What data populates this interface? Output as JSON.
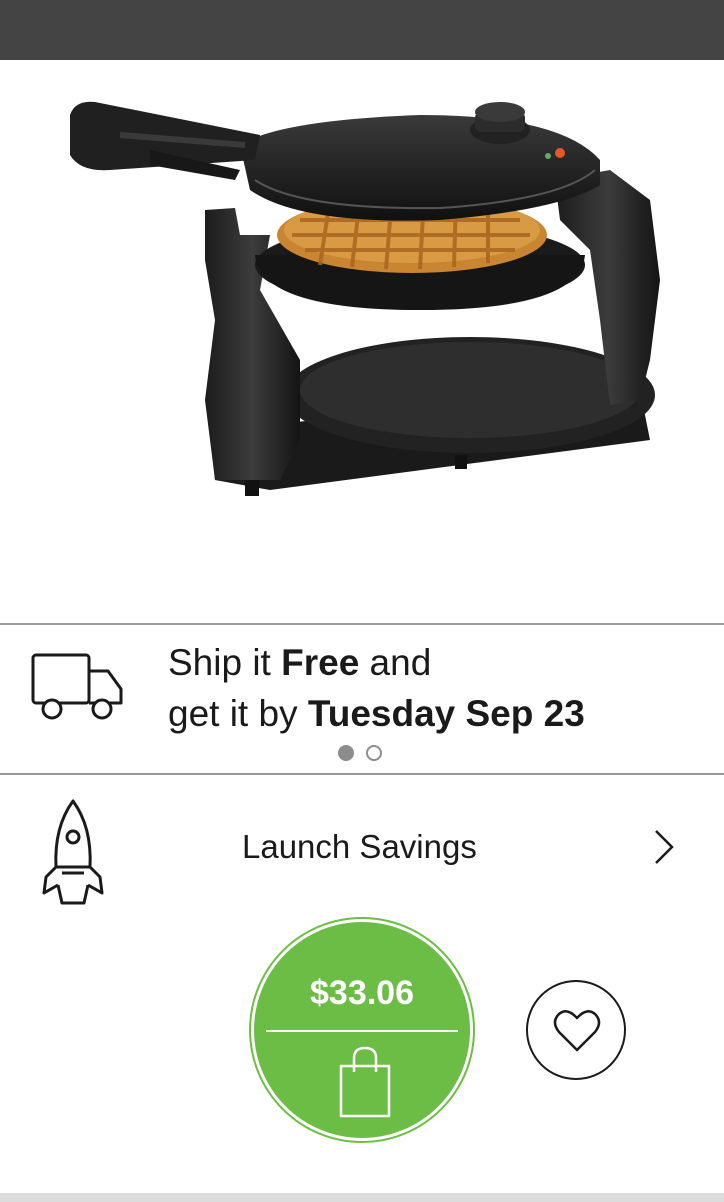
{
  "product": {
    "image_alt": "Rotating waffle maker with golden waffle"
  },
  "shipping": {
    "line1_prefix": "Ship it ",
    "line1_bold": "Free",
    "line1_suffix": " and",
    "line2_prefix": "get it by ",
    "line2_bold": "Tuesday Sep 23",
    "carousel": {
      "count": 2,
      "active_index": 0
    }
  },
  "savings": {
    "label": "Launch Savings"
  },
  "purchase": {
    "price": "$33.06"
  },
  "colors": {
    "accent_green": "#6cbd45",
    "status_bar": "#444444"
  },
  "icons": {
    "shipping": "truck-icon",
    "savings": "rocket-icon",
    "navigate": "chevron-right-icon",
    "buy": "shopping-bag-icon",
    "favorite": "heart-icon"
  }
}
